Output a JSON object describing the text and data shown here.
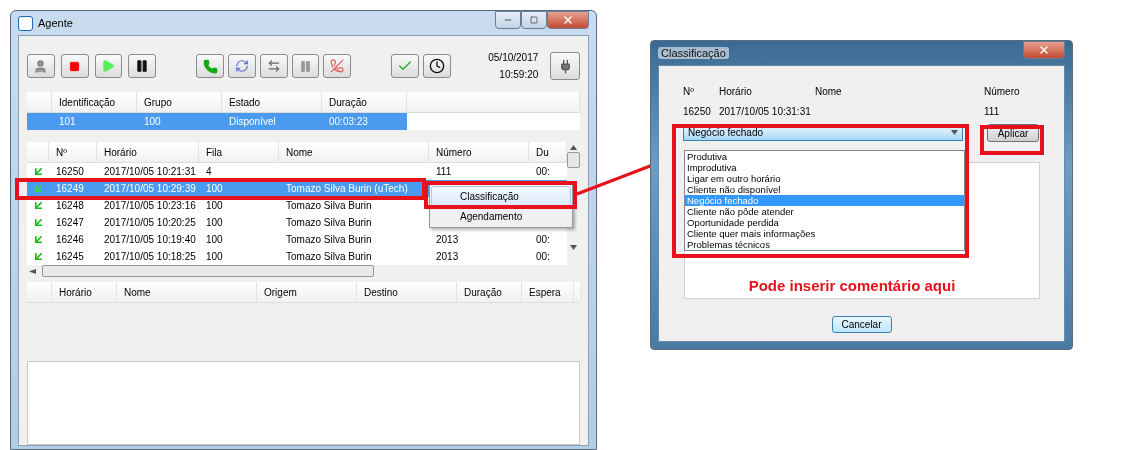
{
  "agent_window": {
    "title": "Agente",
    "date": "05/10/2017",
    "time": "10:59:20",
    "agent_table": {
      "columns": [
        "Identificação",
        "Grupo",
        "Estado",
        "Duração"
      ],
      "rows": [
        {
          "cells": [
            "101",
            "100",
            "Disponível",
            "00:03:23"
          ],
          "selected": true
        }
      ]
    },
    "calls_table": {
      "columns": [
        "Nº",
        "Horário",
        "Fila",
        "Nome",
        "Número",
        "Du"
      ],
      "rows": [
        {
          "number": "16250",
          "time": "2017/10/05 10:21:31",
          "queue": "4",
          "phone": "111",
          "duration": "00:",
          "selected": false
        },
        {
          "number": "16249",
          "time": "2017/10/05 10:29:39",
          "queue": "100",
          "name": "Tomazo Silva Burin (uTech)",
          "selected": true
        },
        {
          "number": "16248",
          "time": "2017/10/05 10:23:16",
          "queue": "100",
          "name": "Tomazo Silva Burin",
          "selected": false
        },
        {
          "number": "16247",
          "time": "2017/10/05 10:20:25",
          "queue": "100",
          "name": "Tomazo Silva Burin",
          "selected": false
        },
        {
          "number": "16246",
          "time": "2017/10/05 10:19:40",
          "queue": "100",
          "name": "Tomazo Silva Burin",
          "phone": "2013",
          "duration": "00:",
          "selected": false
        },
        {
          "number": "16245",
          "time": "2017/10/05 10:18:25",
          "queue": "100",
          "name": "Tomazo Silva Burin",
          "phone": "2013",
          "duration": "00:",
          "selected": false
        }
      ]
    },
    "context_menu": [
      {
        "label": "Classificação",
        "selected": true
      },
      {
        "label": "Agendamento",
        "selected": false
      }
    ],
    "history_table": {
      "columns": [
        "Horário",
        "Nome",
        "Origem",
        "Destino",
        "Duração",
        "Espera"
      ]
    }
  },
  "classification_dialog": {
    "title": "Classificação",
    "fields": [
      {
        "label": "Nº",
        "value": "16250"
      },
      {
        "label": "Horário",
        "value": "2017/10/05 10:31:31"
      },
      {
        "label": "Nome"
      },
      {
        "label": "Número",
        "value": "111"
      }
    ],
    "dropdown": {
      "value": "Negócio fechado",
      "options": [
        {
          "label": "Produtiva",
          "selected": false
        },
        {
          "label": "Improdutiva",
          "selected": false
        },
        {
          "label": "Ligar em outro horário",
          "selected": false
        },
        {
          "label": "Cliente não disponível",
          "selected": false
        },
        {
          "label": "Negócio fechado",
          "selected": true
        },
        {
          "label": "Cliente não pôde atender",
          "selected": false
        },
        {
          "label": "Oportunidade perdida",
          "selected": false
        },
        {
          "label": "Cliente quer mais informações",
          "selected": false
        },
        {
          "label": "Problemas técnicos",
          "selected": false
        }
      ]
    },
    "apply_button": "Aplicar",
    "comment_note": "Pode inserir comentário aqui",
    "cancel_button": "Cancelar"
  }
}
